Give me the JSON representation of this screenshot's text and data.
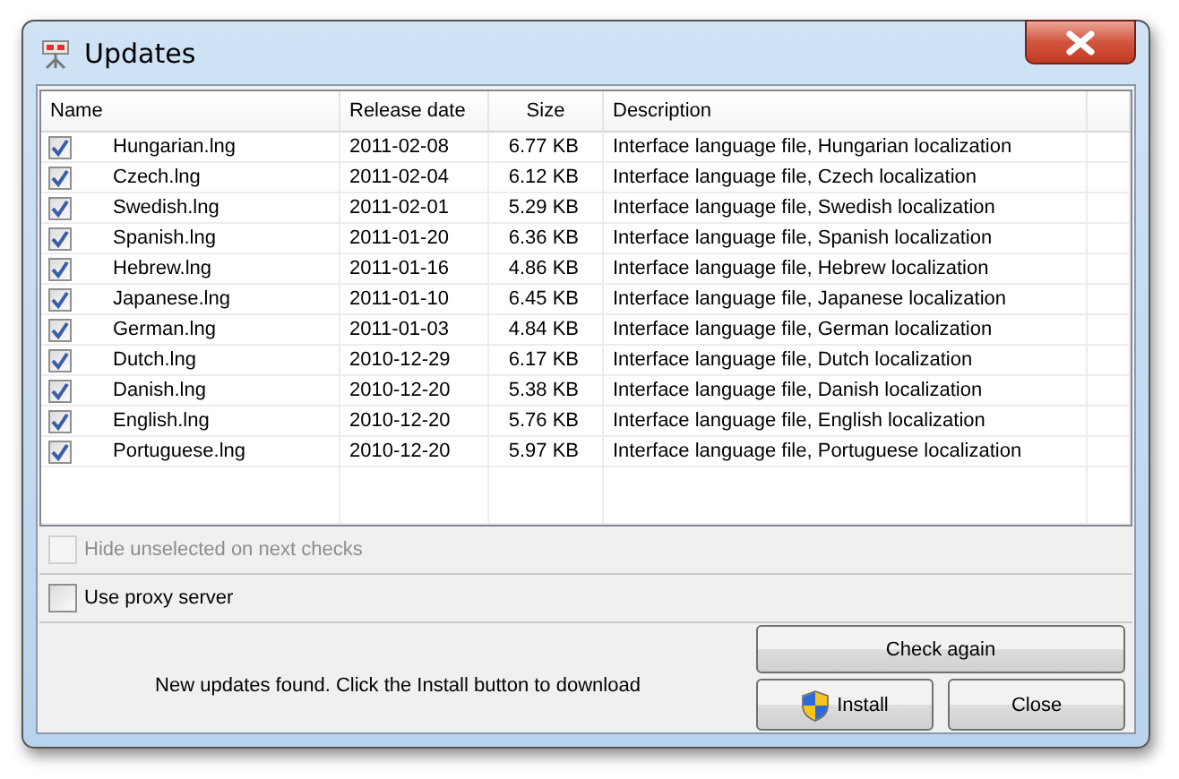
{
  "window": {
    "title": "Updates"
  },
  "table": {
    "columns": [
      "Name",
      "Release date",
      "Size",
      "Description"
    ],
    "rows": [
      {
        "checked": true,
        "name": "Hungarian.lng",
        "date": "2011-02-08",
        "size": "6.77 KB",
        "description": "Interface language file, Hungarian localization"
      },
      {
        "checked": true,
        "name": "Czech.lng",
        "date": "2011-02-04",
        "size": "6.12 KB",
        "description": "Interface language file, Czech localization"
      },
      {
        "checked": true,
        "name": "Swedish.lng",
        "date": "2011-02-01",
        "size": "5.29 KB",
        "description": "Interface language file, Swedish localization"
      },
      {
        "checked": true,
        "name": "Spanish.lng",
        "date": "2011-01-20",
        "size": "6.36 KB",
        "description": "Interface language file, Spanish localization"
      },
      {
        "checked": true,
        "name": "Hebrew.lng",
        "date": "2011-01-16",
        "size": "4.86 KB",
        "description": "Interface language file, Hebrew localization"
      },
      {
        "checked": true,
        "name": "Japanese.lng",
        "date": "2011-01-10",
        "size": "6.45 KB",
        "description": "Interface language file, Japanese localization"
      },
      {
        "checked": true,
        "name": "German.lng",
        "date": "2011-01-03",
        "size": "4.84 KB",
        "description": "Interface language file, German localization"
      },
      {
        "checked": true,
        "name": "Dutch.lng",
        "date": "2010-12-29",
        "size": "6.17 KB",
        "description": "Interface language file, Dutch localization"
      },
      {
        "checked": true,
        "name": "Danish.lng",
        "date": "2010-12-20",
        "size": "5.38 KB",
        "description": "Interface language file, Danish localization"
      },
      {
        "checked": true,
        "name": "English.lng",
        "date": "2010-12-20",
        "size": "5.76 KB",
        "description": "Interface language file, English localization"
      },
      {
        "checked": true,
        "name": "Portuguese.lng",
        "date": "2010-12-20",
        "size": "5.97 KB",
        "description": "Interface language file, Portuguese localization"
      }
    ]
  },
  "options": [
    {
      "label": "Hide unselected on next checks",
      "checked": false,
      "disabled": true
    },
    {
      "label": "Use proxy server",
      "checked": false,
      "disabled": false
    }
  ],
  "status": "New updates found. Click the Install button to download",
  "buttons": {
    "check_again": "Check again",
    "install": "Install",
    "close": "Close"
  }
}
